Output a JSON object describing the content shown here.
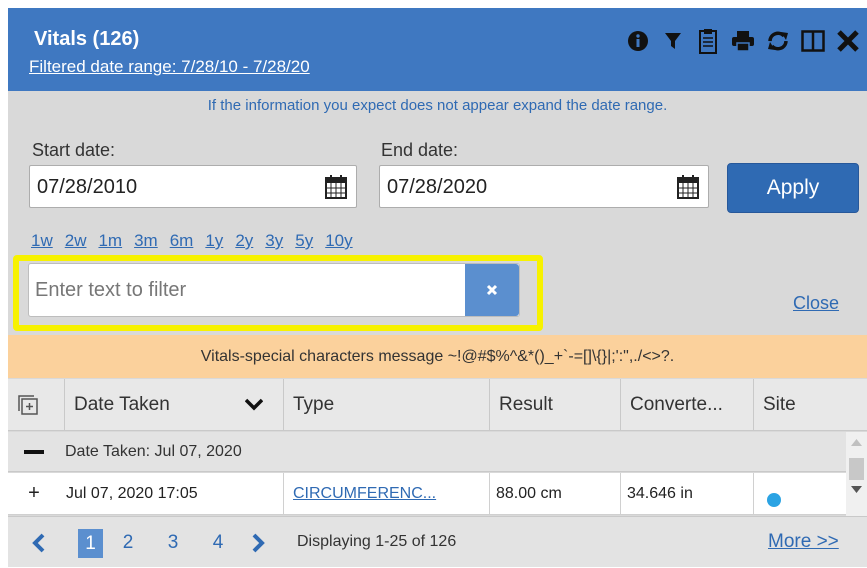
{
  "header": {
    "title": "Vitals (126)",
    "filtered_range": "Filtered date range: 7/28/10 - 7/28/20",
    "icons": [
      "info-icon",
      "filter-icon",
      "clipboard-icon",
      "print-icon",
      "refresh-icon",
      "expand-icon",
      "close-icon"
    ],
    "color": "#3f78c1"
  },
  "filter": {
    "info_message": "If the information you expect does not appear expand the date range.",
    "start_label": "Start date:",
    "start_value": "07/28/2010",
    "end_label": "End date:",
    "end_value": "07/28/2020",
    "apply_label": "Apply",
    "ranges": [
      "1w",
      "2w",
      "1m",
      "3m",
      "6m",
      "1y",
      "2y",
      "3y",
      "5y",
      "10y"
    ],
    "text_filter_placeholder": "Enter text to filter",
    "close_label": "Close"
  },
  "special_message": "Vitals-special characters message ~!@#$%^&*()_+`-=[]\\{}|;':\",./<>?.",
  "grid": {
    "columns": [
      "Date Taken",
      "Type",
      "Result",
      "Converte...",
      "Site"
    ],
    "group_label": "Date Taken:  Jul 07, 2020",
    "rows": [
      {
        "expand": "+",
        "date": "Jul 07, 2020 17:05",
        "type": "CIRCUMFERENC...",
        "result": "88.00 cm",
        "converted": "34.646 in"
      }
    ]
  },
  "pager": {
    "pages": [
      "1",
      "2",
      "3",
      "4"
    ],
    "current": "1",
    "displaying": "Displaying 1-25 of 126",
    "more_label": "More >>"
  }
}
